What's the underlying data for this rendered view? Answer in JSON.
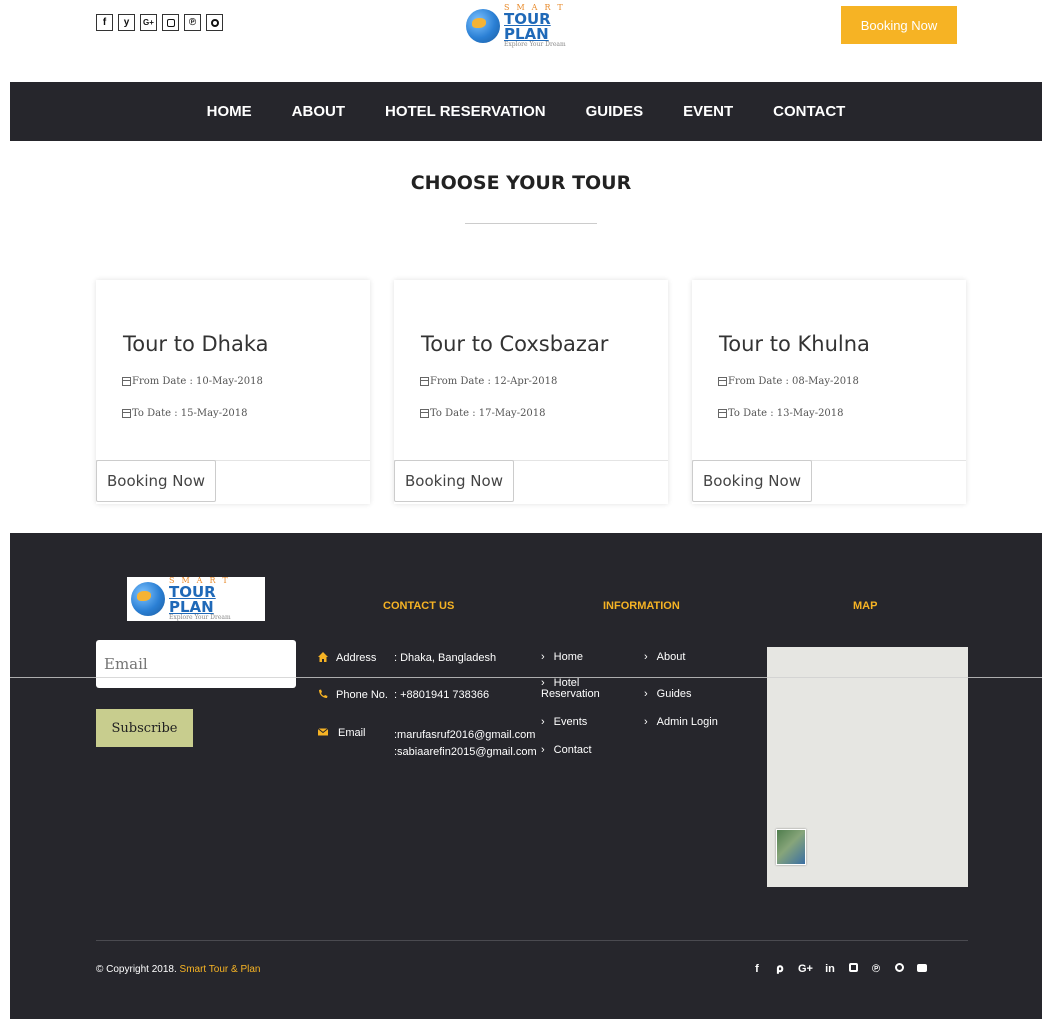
{
  "header": {
    "social_icons": [
      "f",
      "y",
      "G+",
      "ig",
      "p",
      "O"
    ],
    "social_icon_names": [
      "facebook-icon",
      "twitter-icon",
      "google-plus-icon",
      "instagram-icon",
      "pinterest-icon",
      "opera-icon"
    ],
    "logo": {
      "smart": "SMART",
      "main": "TOUR PLAN",
      "tagline": "Explore Your Dream"
    },
    "booking_button": "Booking Now"
  },
  "nav": {
    "items": [
      "HOME",
      "ABOUT",
      "HOTEL RESERVATION",
      "GUIDES",
      "EVENT",
      "CONTACT"
    ]
  },
  "section": {
    "title": "CHOOSE YOUR TOUR"
  },
  "tours": [
    {
      "name": "Tour to Dhaka",
      "from": "From Date : 10-May-2018",
      "to": "To Date : 15-May-2018",
      "button": "Booking Now"
    },
    {
      "name": "Tour to Coxsbazar",
      "from": "From Date : 12-Apr-2018",
      "to": "To Date : 17-May-2018",
      "button": "Booking Now"
    },
    {
      "name": "Tour to Khulna",
      "from": "From Date : 08-May-2018",
      "to": "To Date : 13-May-2018",
      "button": "Booking Now"
    }
  ],
  "footer": {
    "logo": {
      "smart": "SMART",
      "main": "TOUR PLAN",
      "tagline": "Explore Your Dream"
    },
    "email_placeholder": "Email",
    "subscribe_label": "Subscribe",
    "contact": {
      "heading": "CONTACT US",
      "address_label": "Address",
      "address_value": ": Dhaka, Bangladesh",
      "phone_label": "Phone No.",
      "phone_value": ": +8801941 738366",
      "email_label": "Email",
      "email_value_1": ":marufasruf2016@gmail.com",
      "email_value_2": ":sabiaarefin2015@gmail.com"
    },
    "information": {
      "heading": "INFORMATION",
      "col1": [
        "Home",
        "Hotel Reservation",
        "Events",
        "Contact"
      ],
      "col2": [
        "About",
        "Guides",
        "Admin Login"
      ]
    },
    "map_heading": "MAP",
    "copyright_prefix": "© Copyright 2018.",
    "copyright_brand": "Smart Tour & Plan",
    "social_icons": [
      "f",
      "y",
      "G+",
      "in",
      "ig",
      "p",
      "O",
      "yt"
    ]
  },
  "colors": {
    "accent": "#f6b324",
    "dark": "#26262c",
    "subscribe": "#c8cd8e"
  }
}
